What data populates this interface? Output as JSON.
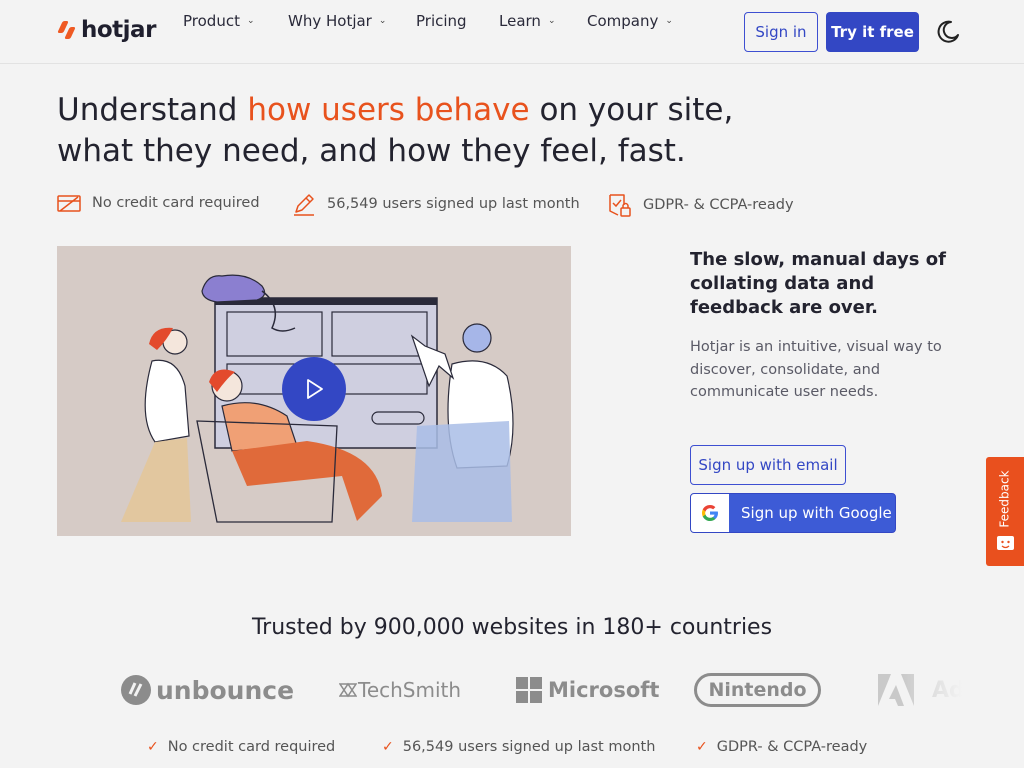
{
  "header": {
    "logo_text": "hotjar",
    "nav": [
      {
        "label": "Product",
        "has_dropdown": true
      },
      {
        "label": "Why Hotjar",
        "has_dropdown": true
      },
      {
        "label": "Pricing",
        "has_dropdown": false
      },
      {
        "label": "Learn",
        "has_dropdown": true
      },
      {
        "label": "Company",
        "has_dropdown": true
      }
    ],
    "sign_in_label": "Sign in",
    "try_label": "Try it free",
    "theme_icon": "moon-icon"
  },
  "hero": {
    "title_before": "Understand ",
    "title_accent": "how users behave",
    "title_after": " on your site, what they need, and how they feel, fast.",
    "perks": [
      {
        "icon": "credit-card-icon",
        "label": "No credit card required"
      },
      {
        "icon": "pencil-icon",
        "label": "56,549 users signed up last month"
      },
      {
        "icon": "shield-lock-icon",
        "label": "GDPR- & CCPA-ready"
      }
    ]
  },
  "video": {
    "play_icon": "play-icon"
  },
  "side": {
    "title": "The slow, manual days of collating data and feedback are over.",
    "text": "Hotjar is an intuitive, visual way to discover, consolidate, and communicate user needs.",
    "email_button": "Sign up with email",
    "google_button": "Sign up with Google"
  },
  "feedback": {
    "label": "Feedback"
  },
  "trusted": {
    "title": "Trusted by 900,000 websites in 180+ countries",
    "logos": [
      "unbounce",
      "TechSmith",
      "Microsoft",
      "Nintendo",
      "Ad"
    ]
  },
  "checks": [
    "No credit card required",
    "56,549 users signed up last month",
    "GDPR- & CCPA-ready"
  ],
  "colors": {
    "accent": "#e8521d",
    "primary": "#3347c4",
    "background": "#f3f3f3"
  }
}
